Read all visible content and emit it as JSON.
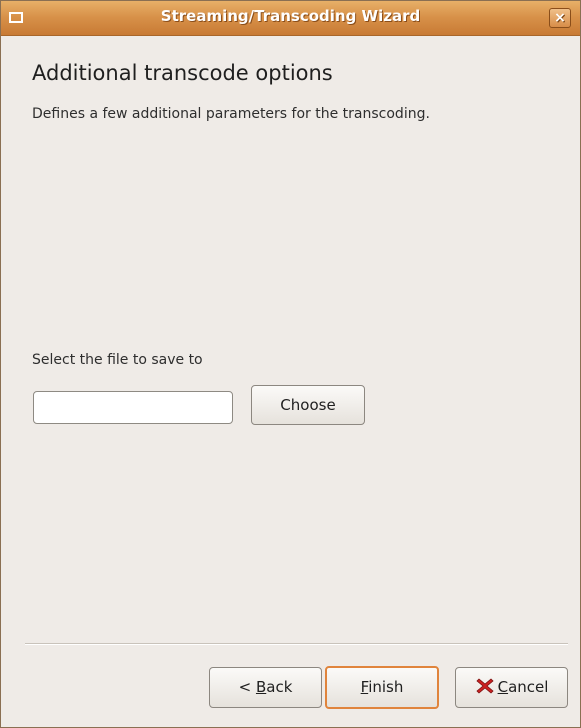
{
  "window": {
    "title": "Streaming/Transcoding Wizard"
  },
  "page": {
    "heading": "Additional transcode options",
    "description": "Defines a few additional parameters for the transcoding."
  },
  "output_file": {
    "label": "Select the file to save to",
    "value": "",
    "choose_label": "Choose"
  },
  "buttons": {
    "back_prefix": "< ",
    "back_mnemonic": "B",
    "back_rest": "ack",
    "finish_mnemonic": "F",
    "finish_rest": "inish",
    "cancel_mnemonic": "C",
    "cancel_rest": "ancel",
    "cancel_icon": "cancel-icon"
  },
  "colors": {
    "titlebar": "#d8924a",
    "background": "#efebe7",
    "default_button_border": "#e0843c",
    "cancel_icon": "#cc2222"
  }
}
